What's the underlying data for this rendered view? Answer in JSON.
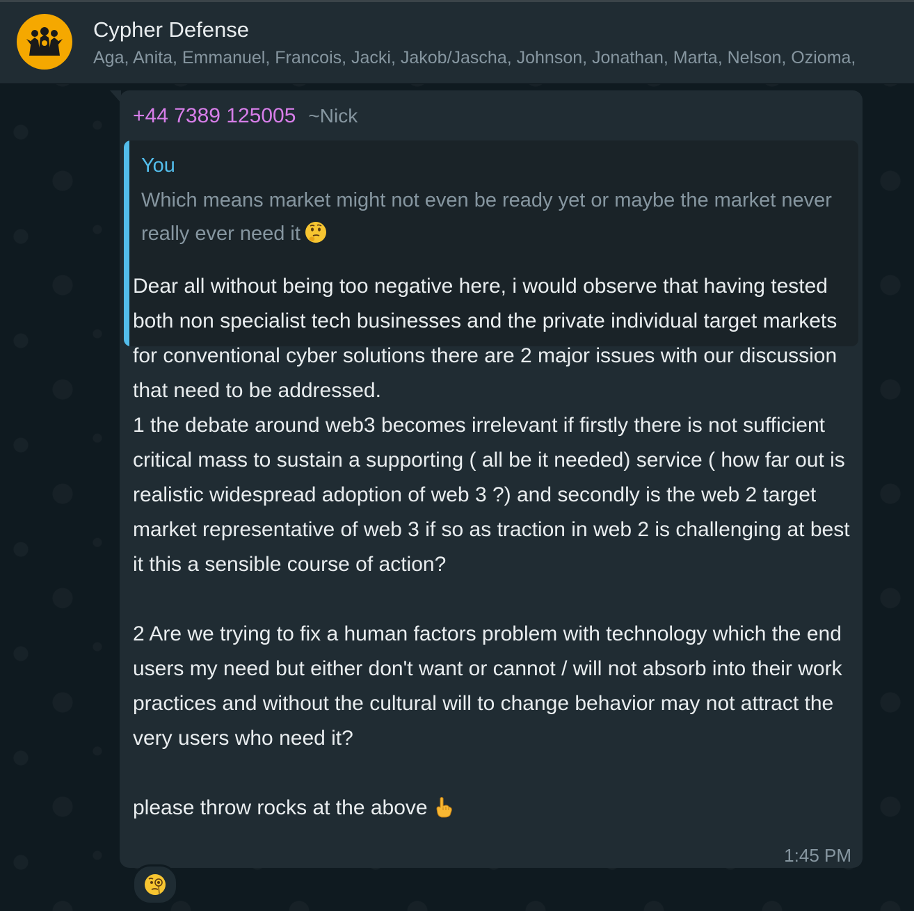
{
  "header": {
    "title": "Cypher Defense",
    "members": "Aga, Anita, Emmanuel, Francois, Jacki, Jakob/Jascha, Johnson, Jonathan, Marta, Nelson, Ozioma,",
    "avatar_icon": "group-logo-icon"
  },
  "message": {
    "sender_phone": "+44 7389 125005",
    "sender_name": "~Nick",
    "quote": {
      "author": "You",
      "text": "Which means market might not even be ready yet or maybe the market never really ever need it",
      "emoji": "thinking-face-icon"
    },
    "body": "Dear all without being too negative here, i would observe that having tested both non specialist tech businesses and the private individual target markets for conventional cyber solutions there are 2 major issues with our discussion that need to be addressed.\n1 the debate around web3 becomes irrelevant if firstly there is not sufficient critical mass to sustain a supporting ( all be it needed) service  ( how far out is realistic widespread adoption of web 3 ?) and secondly is the web 2 target market representative of web 3 if so as traction in web 2 is challenging at best it this a sensible course of action?\n\n2 Are we trying to fix a human factors problem with technology which the end users my need but either don't want or cannot / will not absorb into their work practices and without the cultural will to change behavior may not attract the very users who need it?\n\nplease throw rocks at the above",
    "body_emoji": "pointing-up-icon",
    "time": "1:45 PM",
    "reaction": "face-with-monocle-icon"
  }
}
